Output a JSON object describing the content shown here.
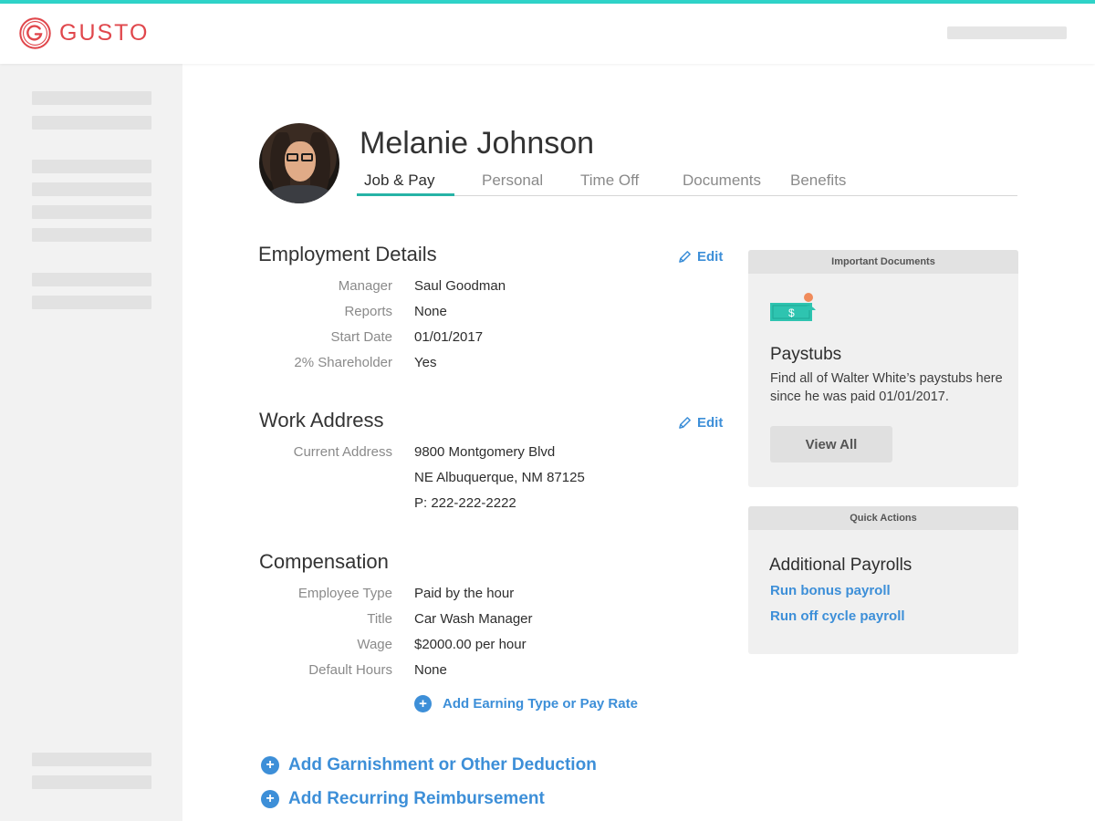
{
  "brand": {
    "name": "GUSTO",
    "accent": "#e0474c",
    "stripe": "#2ed3c8",
    "link": "#3d8fd8"
  },
  "employee": {
    "name": "Melanie Johnson"
  },
  "tabs": [
    {
      "label": "Job & Pay",
      "active": true
    },
    {
      "label": "Personal",
      "active": false
    },
    {
      "label": "Time Off",
      "active": false
    },
    {
      "label": "Documents",
      "active": false
    },
    {
      "label": "Benefits",
      "active": false
    }
  ],
  "employment": {
    "title": "Employment Details",
    "edit_label": "Edit",
    "rows": [
      {
        "label": "Manager",
        "value": "Saul Goodman"
      },
      {
        "label": "Reports",
        "value": "None"
      },
      {
        "label": "Start Date",
        "value": "01/01/2017"
      },
      {
        "label": "2% Shareholder",
        "value": "Yes"
      }
    ]
  },
  "work_address": {
    "title": "Work Address",
    "edit_label": "Edit",
    "label": "Current Address",
    "lines": [
      "9800 Montgomery Blvd",
      "NE Albuquerque, NM 87125",
      "P: 222-222-2222"
    ]
  },
  "compensation": {
    "title": "Compensation",
    "rows": [
      {
        "label": "Employee Type",
        "value": "Paid by the hour"
      },
      {
        "label": "Title",
        "value": "Car Wash Manager"
      },
      {
        "label": "Wage",
        "value": "$2000.00 per hour"
      },
      {
        "label": "Default Hours",
        "value": "None"
      }
    ],
    "add_earning_label": "Add Earning Type or Pay Rate"
  },
  "extra_actions": {
    "garnishment_label": "Add Garnishment or Other Deduction",
    "reimbursement_label": "Add Recurring Reimbursement"
  },
  "important_documents": {
    "header": "Important Documents",
    "icon": "money-paystub-icon",
    "title": "Paystubs",
    "text": "Find all of Walter White’s paystubs here since he was paid 01/01/2017.",
    "button_label": "View All"
  },
  "quick_actions": {
    "header": "Quick Actions",
    "title": "Additional Payrolls",
    "links": [
      "Run bonus payroll",
      "Run off cycle payroll"
    ]
  }
}
